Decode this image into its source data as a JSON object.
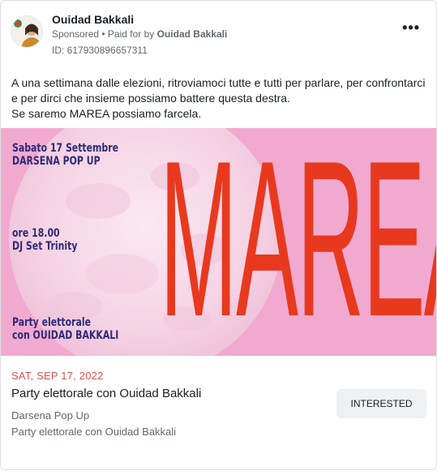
{
  "post": {
    "page_name": "Ouidad Bakkali",
    "sponsored": "Sponsored",
    "paid_prefix": "• Paid for by",
    "paid_by": "Ouidad Bakkali",
    "ad_id": "ID: 617930896657311",
    "more_icon": "more-options-icon",
    "text_line1": "A una settimana dalle elezioni, ritroviamoci tutte e tutti per parlare, per confrontarci e per dirci che insieme possiamo battere questa destra.",
    "text_line2": "Se saremo MAREA possiamo farcela."
  },
  "poster": {
    "date_line1": "Sabato 17 Settembre",
    "date_line2": "DARSENA POP UP",
    "time_line1": "ore 18.00",
    "time_line2": "DJ Set Trinity",
    "party_line1": "Party elettorale",
    "party_line2": "con OUIDAD BAKKALI",
    "title": "MAREA",
    "colors": {
      "background": "#f2a9cf",
      "moon": "#f7dbe9",
      "title": "#e8391e",
      "text": "#2e2a7a"
    }
  },
  "event": {
    "date": "SAT, SEP 17, 2022",
    "title": "Party elettorale con Ouidad Bakkali",
    "location": "Darsena Pop Up",
    "subtitle": "Party elettorale con Ouidad Bakkali",
    "button_label": "INTERESTED"
  }
}
